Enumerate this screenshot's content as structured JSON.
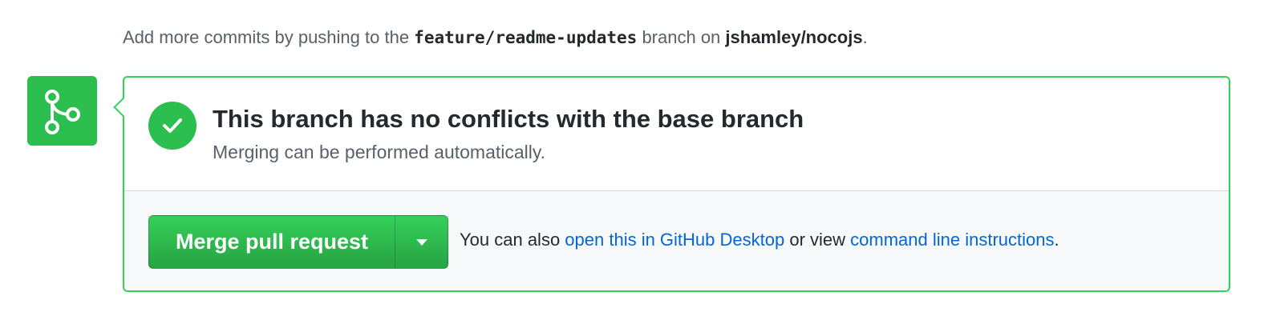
{
  "hint": {
    "prefix": "Add more commits by pushing to the ",
    "branch": "feature/readme-updates",
    "middle": " branch on ",
    "repo": "jshamley/nocojs",
    "suffix": "."
  },
  "status": {
    "title": "This branch has no conflicts with the base branch",
    "subtitle": "Merging can be performed automatically."
  },
  "merge": {
    "button_label": "Merge pull request",
    "dropdown_icon": "triangle-down-icon"
  },
  "alternatives": {
    "prefix": "You can also ",
    "desktop_link": "open this in GitHub Desktop",
    "middle": " or view ",
    "cli_link": "command line instructions",
    "suffix": "."
  },
  "colors": {
    "success_green": "#2cbe4e",
    "border_green": "#34d058",
    "link_blue": "#0366d6",
    "muted_text": "#586069"
  },
  "icons": {
    "merge": "git-merge-icon",
    "status": "check-icon"
  }
}
